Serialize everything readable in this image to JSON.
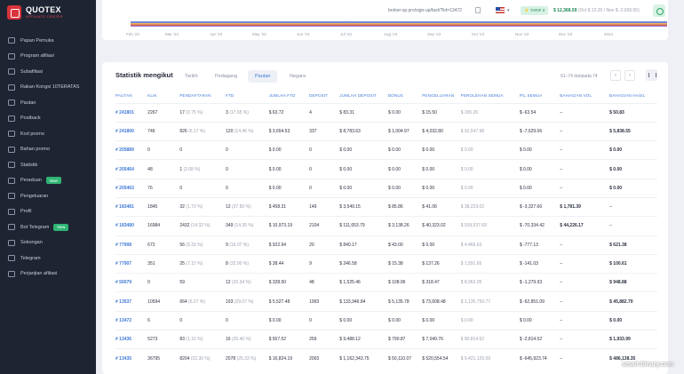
{
  "brand": {
    "title": "QUOTEX",
    "subtitle": "AFFILIATE CENTER"
  },
  "sidebar": {
    "items": [
      {
        "label": "Papan Pemuka",
        "icon": "grid-icon"
      },
      {
        "label": "Program afiliasi",
        "icon": "briefcase-icon"
      },
      {
        "label": "Subafiliasi",
        "icon": "users-icon"
      },
      {
        "label": "Rakan Kongsi 10TERATAS",
        "icon": "chart-icon"
      },
      {
        "label": "Pautan",
        "icon": "link-icon"
      },
      {
        "label": "Postback",
        "icon": "folder-icon"
      },
      {
        "label": "Kod promo",
        "icon": "code-icon"
      },
      {
        "label": "Bahan promo",
        "icon": "image-icon"
      },
      {
        "label": "Statistik",
        "icon": "stats-icon"
      },
      {
        "label": "Peraduan",
        "icon": "trophy-icon",
        "badge": "New"
      },
      {
        "label": "Pengeluaran",
        "icon": "wallet-icon"
      },
      {
        "label": "Profil",
        "icon": "user-icon"
      },
      {
        "label": "Bot Telegram",
        "icon": "bot-icon",
        "badge": "New"
      },
      {
        "label": "Sokongan",
        "icon": "support-icon"
      },
      {
        "label": "Telegram",
        "icon": "telegram-icon"
      },
      {
        "label": "Perjanjian afiliasi",
        "icon": "document-icon"
      }
    ]
  },
  "topbar": {
    "url": "broker-qx.pro/sign-up/fast/?lid=13472",
    "tarif": "TARIF 2",
    "balance": "$ 12,368.59",
    "balance_detail": "(Oct $ 12.20 / Nov $ -2,936.65)"
  },
  "chart_months": [
    "Feb '23",
    "Mar '23",
    "Apr '23",
    "May '23",
    "Jun '23",
    "Jul '23",
    "Aug '23",
    "Sep '23",
    "Oct '23",
    "Nov '23",
    "Dec '23",
    "2024"
  ],
  "stats": {
    "title": "Statistik mengikut",
    "tabs": [
      "Tarikh",
      "Pedagang",
      "Pautan",
      "Negara"
    ],
    "active_tab": "Pautan",
    "range": "61–74 daripada 74",
    "columns": [
      "PAUTAN",
      "KLIK",
      "PENDAFTARAN",
      "FTD",
      "JUMLAH FTD",
      "DEPOSIT",
      "JUMLAH DEPOSIT",
      "BONUS",
      "PENGELUARAN",
      "PEROLEHAN SEMUA",
      "P/L SEMUA",
      "BAHAGIAN VOL",
      "BAHAGIAN HASIL"
    ],
    "rows": [
      [
        "# 241801",
        "2267",
        "17",
        "(0.75 %)",
        "3",
        "(17.65 %)",
        "$ 63.72",
        "4",
        "$ 83.31",
        "$ 0.00",
        "$ 15.50",
        "$ 265.26",
        "$ -63.54",
        "–",
        "$ 50.83"
      ],
      [
        "# 241800",
        "746",
        "826",
        "(6.17 %)",
        "120",
        "(14.46 %)",
        "$ 3,654.53",
        "337",
        "$ 8,783.63",
        "$ 1,004.97",
        "$ 4,032.80",
        "$ 92,547.98",
        "$ -7,629.06",
        "–",
        "$ 5,838.55"
      ],
      [
        "# 205889",
        "0",
        "0",
        "",
        "0",
        "",
        "$ 0.00",
        "0",
        "$ 0.00",
        "$ 0.00",
        "$ 0.00",
        "$ 0.00",
        "$ 0.00",
        "–",
        "$ 0.00"
      ],
      [
        "# 205464",
        "48",
        "1",
        "(2.08 %)",
        "0",
        "",
        "$ 0.00",
        "0",
        "$ 0.00",
        "$ 0.00",
        "$ 0.00",
        "$ 0.00",
        "$ 0.00",
        "–",
        "$ 0.00"
      ],
      [
        "# 205463",
        "76",
        "0",
        "",
        "0",
        "",
        "$ 0.00",
        "0",
        "$ 0.00",
        "$ 0.00",
        "$ 0.00",
        "$ 0.00",
        "$ 0.00",
        "–",
        "$ 0.00"
      ],
      [
        "# 183481",
        "1845",
        "32",
        "(1.73 %)",
        "12",
        "(37.50 %)",
        "$ 458.31",
        "149",
        "$ 3,549.15",
        "$ 85.86",
        "$ 41.06",
        "$ 38,223.02",
        "$ -3,327.66",
        "$ 1,781.39",
        "–"
      ],
      [
        "# 183480",
        "16984",
        "2432",
        "(14.32 %)",
        "349",
        "(14.35 %)",
        "$ 10,973.19",
        "2104",
        "$ 111,653.79",
        "$ 3,138.26",
        "$ 40,323.02",
        "$ 919,537.69",
        "$ -70,334.42",
        "$ 44,226.17",
        "–"
      ],
      [
        "# 77908",
        "672",
        "56",
        "(8.33 %)",
        "9",
        "(16.07 %)",
        "$ 922.94",
        "20",
        "$ 840.17",
        "$ 43.00",
        "$ 0.00",
        "$ 4,466.63",
        "$ -777.13",
        "–",
        "$ 621.38"
      ],
      [
        "# 77907",
        "351",
        "25",
        "(7.12 %)",
        "8",
        "(32.00 %)",
        "$ 38.44",
        "9",
        "$ 246.58",
        "$ 15.38",
        "$ 137.26",
        "$ 1,591.65",
        "$ -141.03",
        "–",
        "$ 100.61"
      ],
      [
        "# 56079",
        "0",
        "59",
        "",
        "12",
        "(20.34 %)",
        "$ 328.50",
        "48",
        "$ 1,525.46",
        "$ 108.96",
        "$ 318.47",
        "$ 8,962.05",
        "$ -1,279.93",
        "–",
        "$ 948.88"
      ],
      [
        "# 13537",
        "10594",
        "664",
        "(6.27 %)",
        "193",
        "(29.07 %)",
        "$ 5,527.48",
        "1993",
        "$ 133,946.84",
        "$ 5,135.78",
        "$ 73,608.48",
        "$ 1,135,793.77",
        "$ -62,851.09",
        "–",
        "$ 45,882.70"
      ],
      [
        "# 13472",
        "6",
        "0",
        "",
        "0",
        "",
        "$ 0.00",
        "0",
        "$ 0.00",
        "$ 0.00",
        "$ 0.00",
        "$ 0.00",
        "$ 0.00",
        "–",
        "$ 0.00"
      ],
      [
        "# 13436",
        "5273",
        "83",
        "(1.15 %)",
        "16",
        "(25.40 %)",
        "$ 557.52",
        "259",
        "$ 9,488.12",
        "$ 790.87",
        "$ 7,049.76",
        "$ 80,814.62",
        "$ -2,814.52",
        "–",
        "$ 1,933.99"
      ],
      [
        "# 13435",
        "36795",
        "8204",
        "(22.30 %)",
        "2078",
        "(25.33 %)",
        "$ 16,824.19",
        "2003",
        "$ 1,162,343.75",
        "$ 50,110.07",
        "$ 520,554.54",
        "$ 9,421,129.59",
        "$ -645,923.74",
        "–",
        "$ 486,138.35"
      ]
    ]
  },
  "watermark": "smart-binary.com"
}
